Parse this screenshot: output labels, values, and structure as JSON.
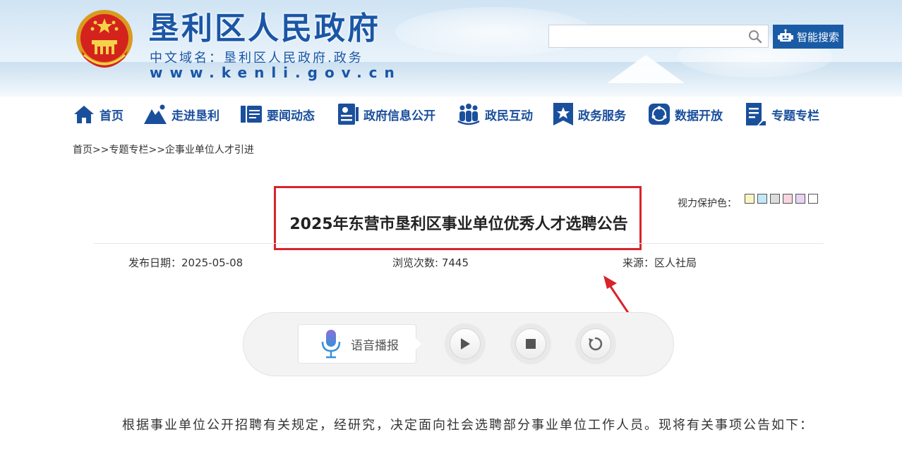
{
  "header": {
    "site_title": "垦利区人民政府",
    "domain_cn": "中文域名：垦利区人民政府.政务",
    "domain_url": "www.kenli.gov.cn",
    "search_placeholder": "",
    "ai_search_label": "智能搜索"
  },
  "nav": {
    "items": [
      {
        "label": "首页",
        "icon": "home-icon"
      },
      {
        "label": "走进垦利",
        "icon": "mountain-icon"
      },
      {
        "label": "要闻动态",
        "icon": "news-icon"
      },
      {
        "label": "政府信息公开",
        "icon": "document-icon"
      },
      {
        "label": "政民互动",
        "icon": "people-icon"
      },
      {
        "label": "政务服务",
        "icon": "star-badge-icon"
      },
      {
        "label": "数据开放",
        "icon": "data-icon"
      },
      {
        "label": "专题专栏",
        "icon": "file-icon"
      }
    ]
  },
  "breadcrumb": "首页>>专题专栏>>企事业单位人才引进",
  "vision": {
    "label": "视力保护色：",
    "colors": [
      "#fbf5c4",
      "#c4e7f8",
      "#dcdcdc",
      "#f9d4e1",
      "#e7d3f4",
      "#ffffff"
    ]
  },
  "article": {
    "title": "2025年东营市垦利区事业单位优秀人才选聘公告",
    "publish_date": "发布日期：2025-05-08",
    "views": "浏览次数: 7445",
    "source": "来源：区人社局",
    "body": "根据事业单位公开招聘有关规定，经研究，决定面向社会选聘部分事业单位工作人员。现将有关事项公告如下："
  },
  "player": {
    "voice_label": "语音播报"
  },
  "colors": {
    "brand_blue": "#1a56a6",
    "annotation_red": "#d9232a"
  }
}
